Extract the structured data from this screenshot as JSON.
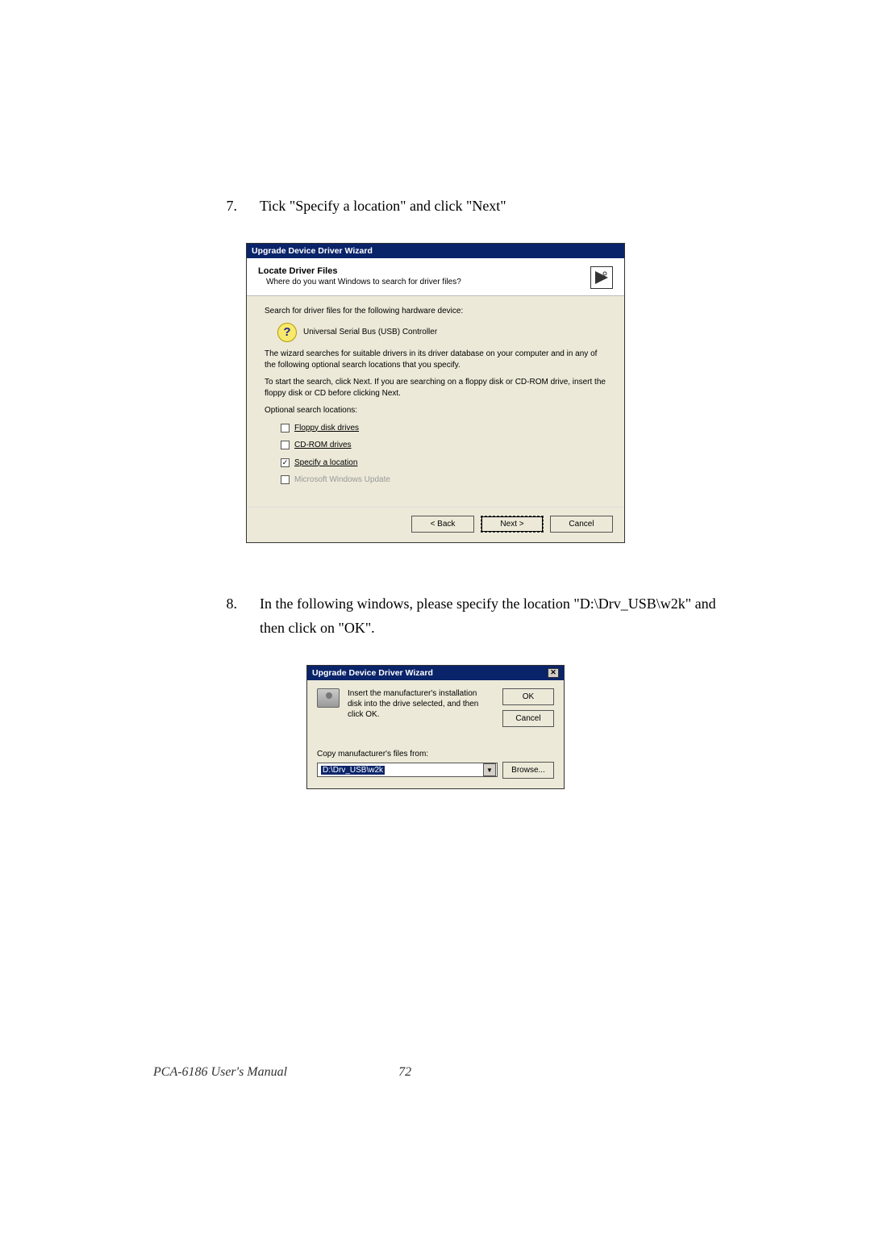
{
  "step7": {
    "num": "7.",
    "text": "Tick \"Specify a location\" and click \"Next\""
  },
  "step8": {
    "num": "8.",
    "text": "In the following windows, please specify the location \"D:\\Drv_USB\\w2k\" and then click on \"OK\"."
  },
  "dialog1": {
    "title": "Upgrade Device Driver Wizard",
    "header_title": "Locate Driver Files",
    "header_sub": "Where do you want Windows to search for driver files?",
    "line1": "Search for driver files for the following hardware device:",
    "device": "Universal Serial Bus (USB) Controller",
    "para1": "The wizard searches for suitable drivers in its driver database on your computer and in any of the following optional search locations that you specify.",
    "para2": "To start the search, click Next. If you are searching on a floppy disk or CD-ROM drive, insert the floppy disk or CD before clicking Next.",
    "opt_label": "Optional search locations:",
    "opt1": "Floppy disk drives",
    "opt2": "CD-ROM drives",
    "opt3": "Specify a location",
    "opt4": "Microsoft Windows Update",
    "btn_back": "< Back",
    "btn_next": "Next >",
    "btn_cancel": "Cancel"
  },
  "dialog2": {
    "title": "Upgrade Device Driver Wizard",
    "msg": "Insert the manufacturer's installation disk into the drive selected, and then click OK.",
    "btn_ok": "OK",
    "btn_cancel": "Cancel",
    "copy_label": "Copy manufacturer's files from:",
    "path": "D:\\Drv_USB\\w2k",
    "btn_browse": "Browse..."
  },
  "footer": {
    "manual": "PCA-6186 User's Manual",
    "page_num": "72"
  }
}
